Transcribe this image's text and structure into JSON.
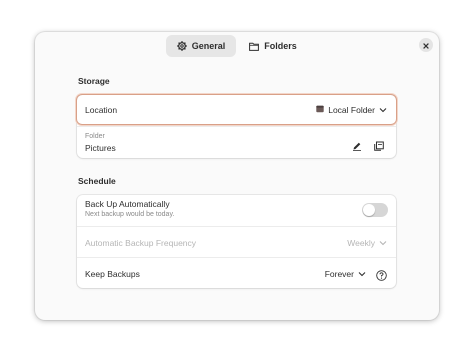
{
  "tabs": [
    {
      "label": "General",
      "icon": "gear-icon",
      "selected": true
    },
    {
      "label": "Folders",
      "icon": "folder-icon",
      "selected": false
    }
  ],
  "storage": {
    "title": "Storage",
    "location_label": "Location",
    "location_value": "Local Folder",
    "folder_caption": "Folder",
    "folder_value": "Pictures"
  },
  "schedule": {
    "title": "Schedule",
    "auto_label": "Back Up Automatically",
    "auto_sub": "Next backup would be today.",
    "auto_enabled": false,
    "freq_label": "Automatic Backup Frequency",
    "freq_value": "Weekly",
    "keep_label": "Keep Backups",
    "keep_value": "Forever"
  },
  "colors": {
    "accent_focus": "#d9a088",
    "window_bg": "#fafafa"
  }
}
